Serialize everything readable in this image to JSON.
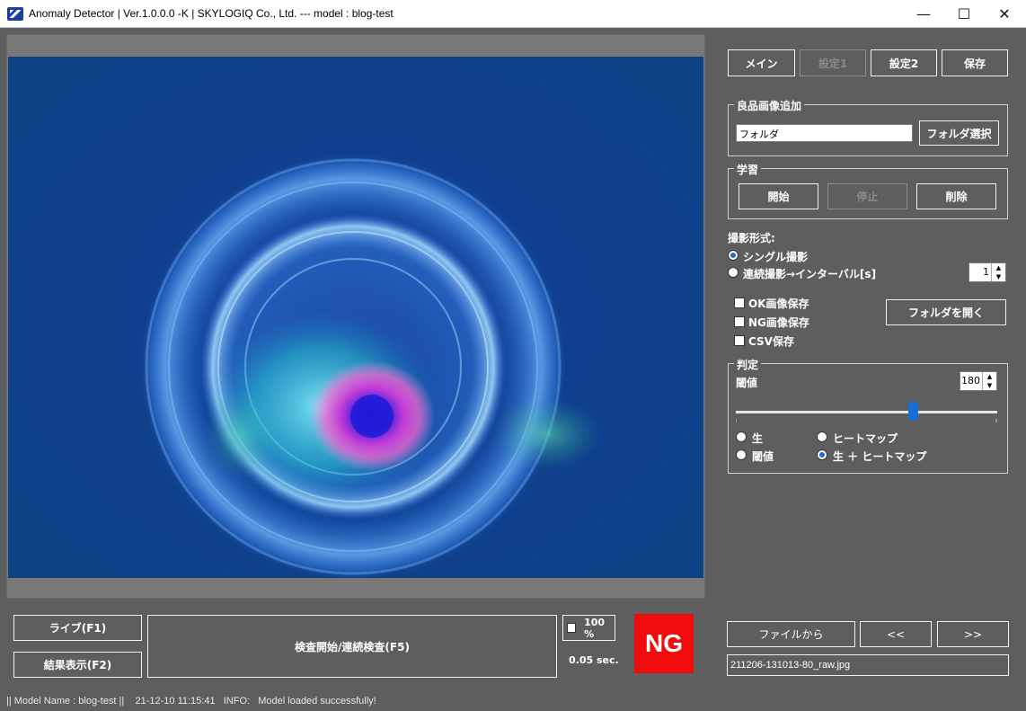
{
  "window": {
    "title": "Anomaly Detector | Ver.1.0.0.0 -K | SKYLOGIQ Co., Ltd. --- model : blog-test",
    "minimize_glyph": "—",
    "maximize_glyph": "☐",
    "close_glyph": "✕"
  },
  "tabs": {
    "main": "メイン",
    "settings1": "設定1",
    "settings2": "設定2",
    "save": "保存"
  },
  "good_image": {
    "legend": "良品画像追加",
    "folder_value": "フォルダ",
    "folder_select": "フォルダ選択"
  },
  "learning": {
    "legend": "学習",
    "start": "開始",
    "stop": "停止",
    "delete": "削除"
  },
  "capture": {
    "label": "撮影形式:",
    "single": "シングル撮影",
    "continuous": "連続撮影→インターバル[s]",
    "interval_value": "1",
    "selected": "single"
  },
  "saving": {
    "ok_save": "OK画像保存",
    "ng_save": "NG画像保存",
    "csv_save": "CSV保存",
    "open_folder": "フォルダを開く"
  },
  "judgement": {
    "legend": "判定",
    "threshold_label": "閾値",
    "threshold_value": "180",
    "slider_fraction": 0.68,
    "raw": "生",
    "heatmap": "ヒートマップ",
    "threshold_view": "閾値",
    "raw_heatmap": "生 ＋ ヒートマップ",
    "selected_view": "raw_heatmap"
  },
  "controls": {
    "live": "ライブ(F1)",
    "result": "結果表示(F2)",
    "inspect": "検査開始/連続検査(F5)",
    "zoom": "100 %",
    "time": "0.05 sec.",
    "verdict": "NG"
  },
  "file_nav": {
    "from_file": "ファイルから",
    "prev": "<<",
    "next": ">>",
    "filename": "211206-131013-80_raw.jpg"
  },
  "status": "|| Model Name : blog-test ||    21-12-10 11:15:41   INFO:   Model loaded successfully!"
}
